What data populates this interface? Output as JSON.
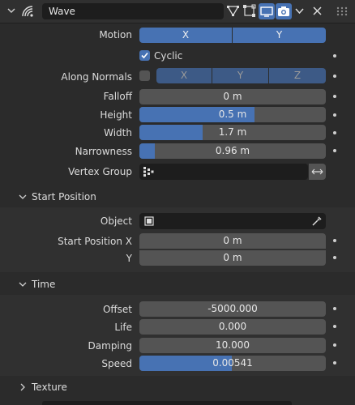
{
  "header": {
    "name": "Wave"
  },
  "motion": {
    "label": "Motion",
    "x": "X",
    "y": "Y"
  },
  "cyclic": {
    "label": "Cyclic",
    "checked": true
  },
  "along_normals": {
    "label": "Along Normals",
    "x": "X",
    "y": "Y",
    "z": "Z"
  },
  "falloff": {
    "label": "Falloff",
    "value": "0 m"
  },
  "height": {
    "label": "Height",
    "value": "0.5 m"
  },
  "width": {
    "label": "Width",
    "value": "1.7 m"
  },
  "narrowness": {
    "label": "Narrowness",
    "value": "0.96 m"
  },
  "vertex_group": {
    "label": "Vertex Group"
  },
  "start_position": {
    "title": "Start Position",
    "object_label": "Object",
    "x_label": "Start Position X",
    "x_value": "0 m",
    "y_label": "Y",
    "y_value": "0 m"
  },
  "time": {
    "title": "Time",
    "offset_label": "Offset",
    "offset_value": "-5000.000",
    "life_label": "Life",
    "life_value": "0.000",
    "damping_label": "Damping",
    "damping_value": "10.000",
    "speed_label": "Speed",
    "speed_value": "0.00541"
  },
  "texture": {
    "title": "Texture"
  },
  "colors": {
    "accent": "#4772b3",
    "field": "#545454",
    "panel": "#303030"
  }
}
